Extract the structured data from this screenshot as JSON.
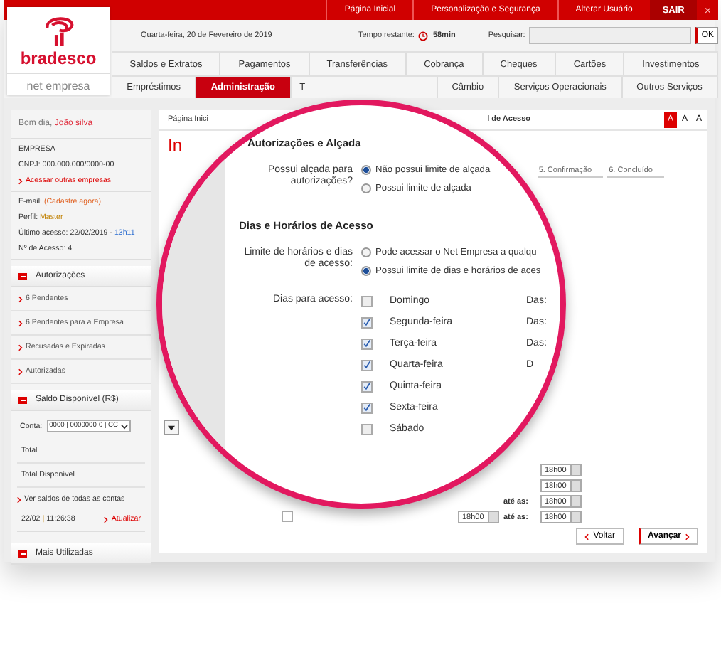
{
  "top_links": [
    {
      "label": "Página Inicial"
    },
    {
      "label": "Personalização e Segurança"
    },
    {
      "label": "Alterar Usuário"
    }
  ],
  "logout": {
    "label": "SAIR",
    "close": "×"
  },
  "logo": {
    "name": "bradesco",
    "subtitle": "net empresa"
  },
  "header": {
    "date": "Quarta-feira, 20 de Fevereiro de 2019",
    "timer_label": "Tempo restante:",
    "timer_value": "58min",
    "search_label": "Pesquisar:",
    "search_button": "OK"
  },
  "nav_rows": [
    [
      {
        "label": "Saldos e Extratos",
        "selected": false
      },
      {
        "label": "Pagamentos",
        "selected": false
      },
      {
        "label": "Transferências",
        "selected": false
      },
      {
        "label": "Cobrança",
        "selected": false
      },
      {
        "label": "Cheques",
        "selected": false
      },
      {
        "label": "Cartões",
        "selected": false
      },
      {
        "label": "Investimentos",
        "selected": false
      }
    ],
    [
      {
        "label": "Empréstimos",
        "selected": false
      },
      {
        "label": "Administração",
        "selected": true
      },
      {
        "label": "T",
        "selected": false
      },
      {
        "label": "Câmbio",
        "selected": false
      },
      {
        "label": "Serviços Operacionais",
        "selected": false
      },
      {
        "label": "Outros Serviços",
        "selected": false
      }
    ]
  ],
  "sidebar": {
    "greeting": "Bom dia,",
    "user": "João silva",
    "company": "EMPRESA",
    "cnpj": "CNPJ: 000.000.000/0000-00",
    "other_companies": "Acessar outras empresas",
    "email_label": "E-mail:",
    "email_link": "(Cadastre agora)",
    "profile_label": "Perfil:",
    "profile": "Master",
    "last_access": "Último acesso: 22/02/2019 -",
    "last_access_time": "13h11",
    "access_count": "Nº de Acesso: 4",
    "authorizations": {
      "title": "Autorizações",
      "items": [
        "6 Pendentes",
        "6 Pendentes para a Empresa",
        "Recusadas e Expiradas",
        "Autorizadas"
      ]
    },
    "balance": {
      "title": "Saldo Disponível (R$)",
      "account_label": "Conta:",
      "account": "0000 | 0000000-0 | CC",
      "rows": [
        "Total",
        "Total Disponível"
      ],
      "all_accounts": "Ver saldos de todas as contas",
      "date": "22/02",
      "separator": "|",
      "time": "11:26:38",
      "refresh": "Atualizar"
    },
    "most_used": {
      "title": "Mais Utilizadas"
    }
  },
  "main": {
    "breadcrumb_start": "Página Inici",
    "breadcrumb_end": "l de Acesso",
    "font_sizes": [
      {
        "label": "A",
        "selected": true
      },
      {
        "label": "A",
        "selected": false
      },
      {
        "label": "A",
        "selected": false
      }
    ],
    "title": "In",
    "steps": [
      "5. Confirmação",
      "6. Concluído"
    ],
    "time_rows": [
      {
        "end": "18h00"
      },
      {
        "end": "18h00"
      },
      {
        "until": "até as:",
        "end": "18h00"
      },
      {
        "checkbox": false,
        "start": "18h00",
        "until": "até as:",
        "end": "18h00"
      }
    ],
    "back": "Voltar",
    "next": "Avançar"
  },
  "magnifier": {
    "section_1": "Autorizações e Alçada",
    "question_1": "Possui alçada para autorizações?",
    "options_1": [
      {
        "label": "Não possui limite de alçada",
        "selected": true
      },
      {
        "label": "Possui limite de alçada",
        "selected": false
      }
    ],
    "section_2": "Dias e Horários de Acesso",
    "question_2": "Limite de horários e dias de acesso:",
    "options_2": [
      {
        "label": "Pode acessar o Net Empresa a qualqu",
        "selected": false
      },
      {
        "label": "Possui limite de dias e horários de aces",
        "selected": true
      }
    ],
    "days_label": "Dias para acesso:",
    "days": [
      {
        "name": "Domingo",
        "checked": false,
        "hours": "Das:"
      },
      {
        "name": "Segunda-feira",
        "checked": true,
        "hours": "Das:"
      },
      {
        "name": "Terça-feira",
        "checked": true,
        "hours": "Das:"
      },
      {
        "name": "Quarta-feira",
        "checked": true,
        "hours": "D"
      },
      {
        "name": "Quinta-feira",
        "checked": true
      },
      {
        "name": "Sexta-feira",
        "checked": true
      },
      {
        "name": "Sábado",
        "checked": false
      }
    ]
  }
}
